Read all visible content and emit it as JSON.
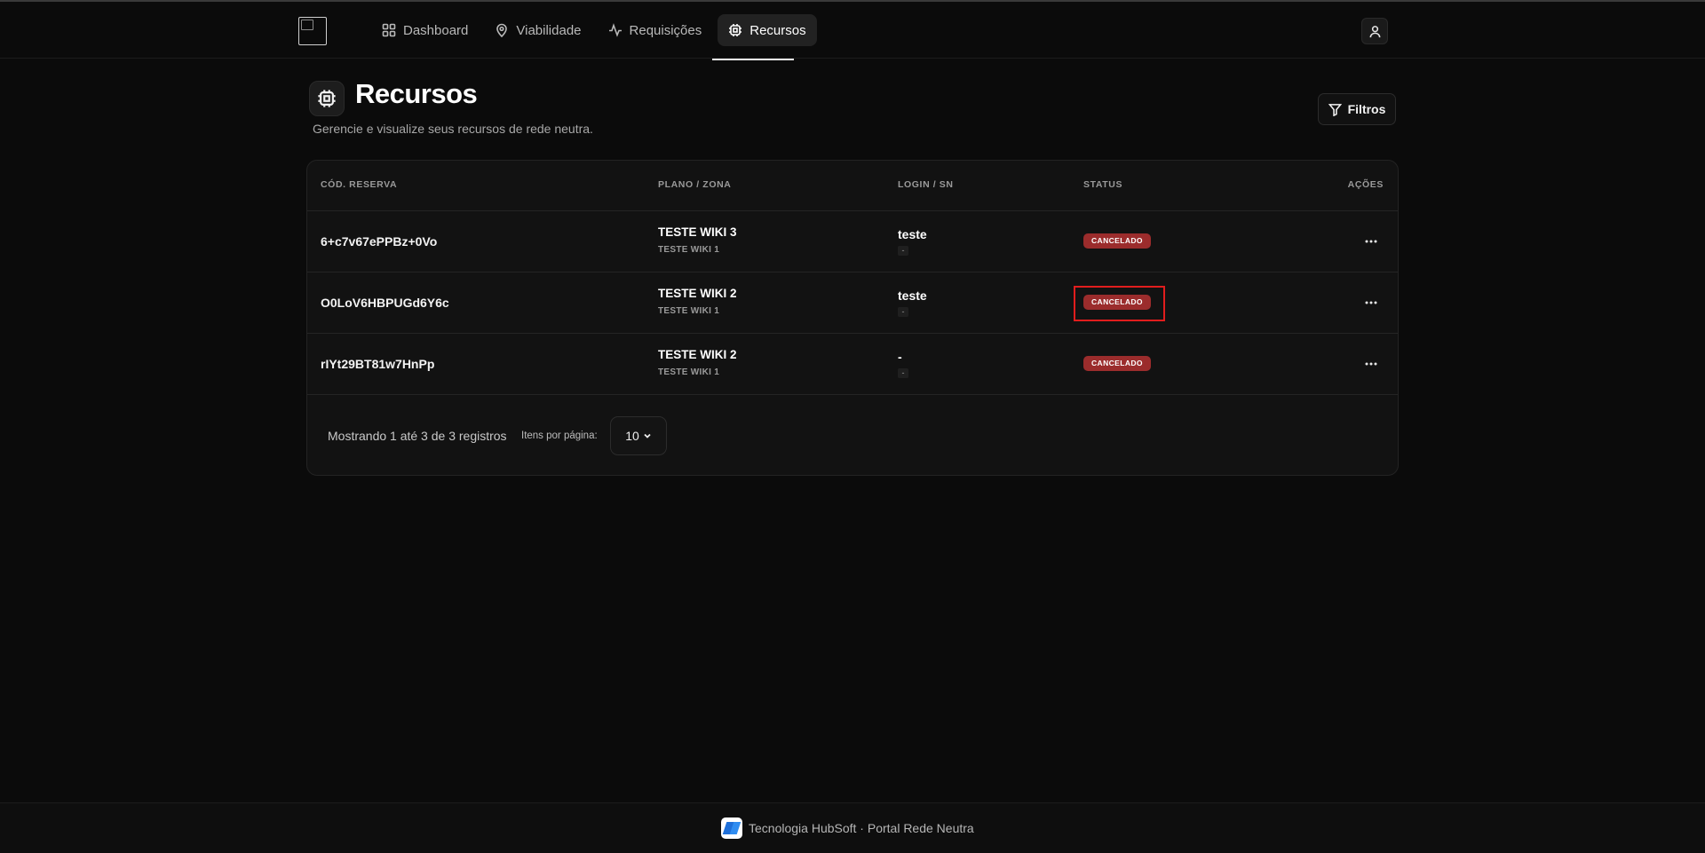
{
  "nav": {
    "items": [
      {
        "label": "Dashboard",
        "icon": "grid-icon",
        "active": false
      },
      {
        "label": "Viabilidade",
        "icon": "map-pin-icon",
        "active": false
      },
      {
        "label": "Requisições",
        "icon": "activity-icon",
        "active": false
      },
      {
        "label": "Recursos",
        "icon": "cpu-icon",
        "active": true
      }
    ]
  },
  "page": {
    "title": "Recursos",
    "subtitle": "Gerencie e visualize seus recursos de rede neutra.",
    "filter_label": "Filtros"
  },
  "table": {
    "headers": {
      "code": "CÓD. RESERVA",
      "plan": "PLANO / ZONA",
      "login": "LOGIN / SN",
      "status": "STATUS",
      "actions": "AÇÕES"
    },
    "rows": [
      {
        "code": "6+c7v67ePPBz+0Vo",
        "plan": "TESTE WIKI 3",
        "zone": "TESTE WIKI 1",
        "login": "teste",
        "sn": "-",
        "status": "CANCELADO"
      },
      {
        "code": "O0LoV6HBPUGd6Y6c",
        "plan": "TESTE WIKI 2",
        "zone": "TESTE WIKI 1",
        "login": "teste",
        "sn": "-",
        "status": "CANCELADO"
      },
      {
        "code": "rIYt29BT81w7HnPp",
        "plan": "TESTE WIKI 2",
        "zone": "TESTE WIKI 1",
        "login": "-",
        "sn": "-",
        "status": "CANCELADO"
      }
    ]
  },
  "pagination": {
    "showing": "Mostrando 1 até 3 de 3 registros",
    "items_per_page_label": "Itens por página:",
    "items_per_page_value": "10"
  },
  "footer": {
    "text": "Tecnologia HubSoft · Portal Rede Neutra"
  },
  "colors": {
    "background": "#0b0b0b",
    "card": "#121212",
    "status_cancelled": "#9b2c2c",
    "highlight": "#e11d1d"
  }
}
